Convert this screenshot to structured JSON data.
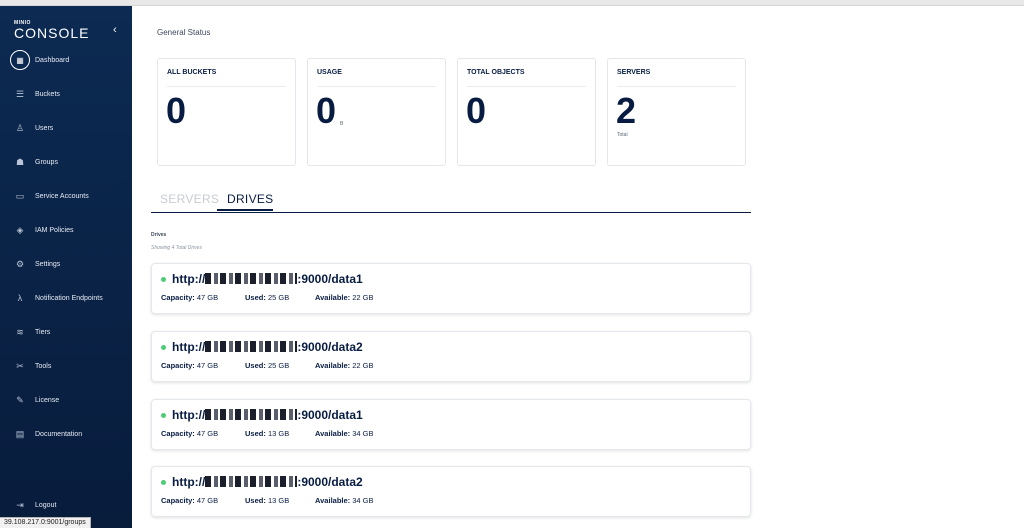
{
  "sidebar": {
    "logo_small": "MINIO",
    "logo_big": "CONSOLE",
    "items": [
      {
        "label": "Dashboard",
        "icon": "dashboard-icon",
        "glyph": "▦",
        "active": true
      },
      {
        "label": "Buckets",
        "icon": "bucket-icon",
        "glyph": "☰"
      },
      {
        "label": "Users",
        "icon": "user-icon",
        "glyph": "♙"
      },
      {
        "label": "Groups",
        "icon": "groups-icon",
        "glyph": "☗"
      },
      {
        "label": "Service Accounts",
        "icon": "service-accounts-icon",
        "glyph": "▭"
      },
      {
        "label": "IAM Policies",
        "icon": "shield-icon",
        "glyph": "◈"
      },
      {
        "label": "Settings",
        "icon": "gear-icon",
        "glyph": "⚙"
      },
      {
        "label": "Notification Endpoints",
        "icon": "lambda-icon",
        "glyph": "λ"
      },
      {
        "label": "Tiers",
        "icon": "tiers-icon",
        "glyph": "≋"
      },
      {
        "label": "Tools",
        "icon": "tools-icon",
        "glyph": "✂"
      },
      {
        "label": "License",
        "icon": "license-icon",
        "glyph": "✎"
      },
      {
        "label": "Documentation",
        "icon": "documentation-icon",
        "glyph": "▤"
      }
    ],
    "logout": {
      "label": "Logout",
      "icon": "logout-icon",
      "glyph": "⇥"
    }
  },
  "status_bar_url": "39.108.217.0:9001/groups",
  "general_status": {
    "title": "General Status",
    "cards": [
      {
        "label": "ALL BUCKETS",
        "value": "0",
        "unit": "",
        "sub": ""
      },
      {
        "label": "USAGE",
        "value": "0",
        "unit": "B",
        "sub": ""
      },
      {
        "label": "TOTAL OBJECTS",
        "value": "0",
        "unit": "",
        "sub": ""
      },
      {
        "label": "SERVERS",
        "value": "2",
        "unit": "",
        "sub": "Total"
      }
    ]
  },
  "tabs": [
    {
      "label": "SERVERS",
      "active": false
    },
    {
      "label": "DRIVES",
      "active": true
    }
  ],
  "drives": {
    "title": "Drives",
    "subtitle": "Showing 4 Total Drives",
    "capacity_label": "Capacity:",
    "used_label": "Used:",
    "available_label": "Available:",
    "items": [
      {
        "url_prefix": "http://",
        "url_suffix": ":9000/data1",
        "capacity": "47 GB",
        "used": "25 GB",
        "available": "22 GB",
        "status_color": "#4ccb78"
      },
      {
        "url_prefix": "http://",
        "url_suffix": ":9000/data2",
        "capacity": "47 GB",
        "used": "25 GB",
        "available": "22 GB",
        "status_color": "#4ccb78"
      },
      {
        "url_prefix": "http://",
        "url_suffix": ":9000/data1",
        "capacity": "47 GB",
        "used": "13 GB",
        "available": "34 GB",
        "status_color": "#4ccb78"
      },
      {
        "url_prefix": "http://",
        "url_suffix": ":9000/data2",
        "capacity": "47 GB",
        "used": "13 GB",
        "available": "34 GB",
        "status_color": "#4ccb78"
      }
    ]
  }
}
